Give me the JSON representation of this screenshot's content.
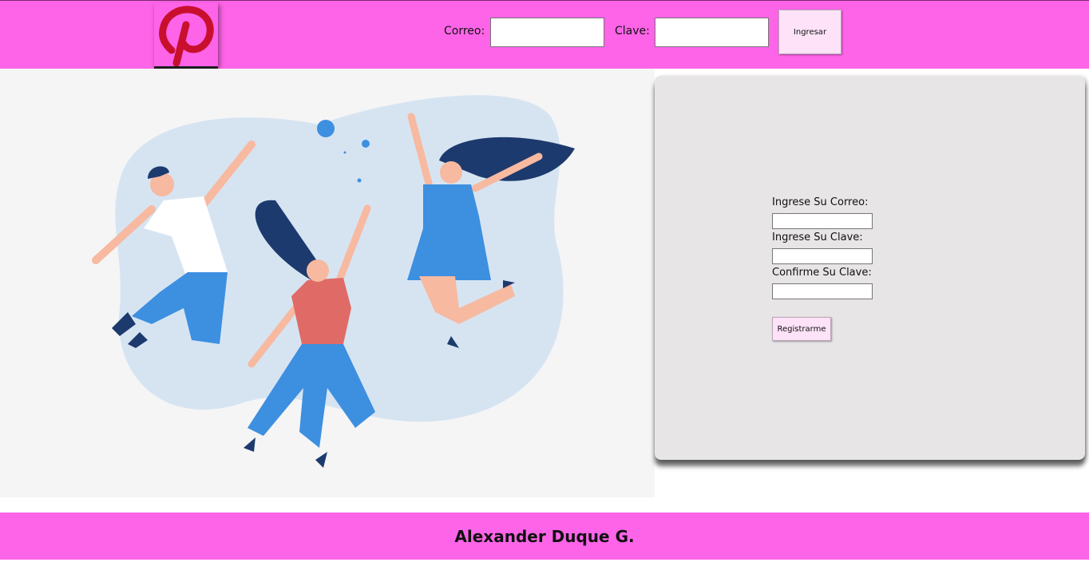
{
  "header": {
    "email_label": "Correo:",
    "password_label": "Clave:",
    "login_button": "Ingresar"
  },
  "register": {
    "email_label": "Ingrese Su Correo:",
    "password_label": "Ingrese Su Clave:",
    "confirm_label": "Confirme Su Clave:",
    "register_button": "Registrarme"
  },
  "footer": {
    "author": "Alexander Duque G."
  },
  "icons": {
    "logo": "pinterest-logo-icon"
  },
  "colors": {
    "brand_pink": "#fd64e8",
    "button_bg": "#fde2f8",
    "card_bg": "#e7e5e6",
    "logo_red": "#c8102e"
  }
}
